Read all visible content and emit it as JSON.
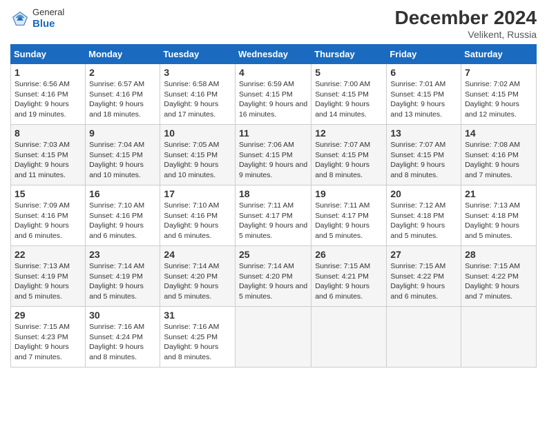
{
  "header": {
    "logo_general": "General",
    "logo_blue": "Blue",
    "month_year": "December 2024",
    "location": "Velikent, Russia"
  },
  "calendar": {
    "headers": [
      "Sunday",
      "Monday",
      "Tuesday",
      "Wednesday",
      "Thursday",
      "Friday",
      "Saturday"
    ],
    "weeks": [
      [
        null,
        {
          "day": "2",
          "sunrise": "6:57 AM",
          "sunset": "4:16 PM",
          "daylight": "9 hours and 18 minutes."
        },
        {
          "day": "3",
          "sunrise": "6:58 AM",
          "sunset": "4:16 PM",
          "daylight": "9 hours and 17 minutes."
        },
        {
          "day": "4",
          "sunrise": "6:59 AM",
          "sunset": "4:15 PM",
          "daylight": "9 hours and 16 minutes."
        },
        {
          "day": "5",
          "sunrise": "7:00 AM",
          "sunset": "4:15 PM",
          "daylight": "9 hours and 14 minutes."
        },
        {
          "day": "6",
          "sunrise": "7:01 AM",
          "sunset": "4:15 PM",
          "daylight": "9 hours and 13 minutes."
        },
        {
          "day": "7",
          "sunrise": "7:02 AM",
          "sunset": "4:15 PM",
          "daylight": "9 hours and 12 minutes."
        }
      ],
      [
        {
          "day": "1",
          "sunrise": "6:56 AM",
          "sunset": "4:16 PM",
          "daylight": "9 hours and 19 minutes."
        },
        {
          "day": "9",
          "sunrise": "7:04 AM",
          "sunset": "4:15 PM",
          "daylight": "9 hours and 10 minutes."
        },
        {
          "day": "10",
          "sunrise": "7:05 AM",
          "sunset": "4:15 PM",
          "daylight": "9 hours and 10 minutes."
        },
        {
          "day": "11",
          "sunrise": "7:06 AM",
          "sunset": "4:15 PM",
          "daylight": "9 hours and 9 minutes."
        },
        {
          "day": "12",
          "sunrise": "7:07 AM",
          "sunset": "4:15 PM",
          "daylight": "9 hours and 8 minutes."
        },
        {
          "day": "13",
          "sunrise": "7:07 AM",
          "sunset": "4:15 PM",
          "daylight": "9 hours and 8 minutes."
        },
        {
          "day": "14",
          "sunrise": "7:08 AM",
          "sunset": "4:16 PM",
          "daylight": "9 hours and 7 minutes."
        }
      ],
      [
        {
          "day": "8",
          "sunrise": "7:03 AM",
          "sunset": "4:15 PM",
          "daylight": "9 hours and 11 minutes."
        },
        {
          "day": "16",
          "sunrise": "7:10 AM",
          "sunset": "4:16 PM",
          "daylight": "9 hours and 6 minutes."
        },
        {
          "day": "17",
          "sunrise": "7:10 AM",
          "sunset": "4:16 PM",
          "daylight": "9 hours and 6 minutes."
        },
        {
          "day": "18",
          "sunrise": "7:11 AM",
          "sunset": "4:17 PM",
          "daylight": "9 hours and 5 minutes."
        },
        {
          "day": "19",
          "sunrise": "7:11 AM",
          "sunset": "4:17 PM",
          "daylight": "9 hours and 5 minutes."
        },
        {
          "day": "20",
          "sunrise": "7:12 AM",
          "sunset": "4:18 PM",
          "daylight": "9 hours and 5 minutes."
        },
        {
          "day": "21",
          "sunrise": "7:13 AM",
          "sunset": "4:18 PM",
          "daylight": "9 hours and 5 minutes."
        }
      ],
      [
        {
          "day": "15",
          "sunrise": "7:09 AM",
          "sunset": "4:16 PM",
          "daylight": "9 hours and 6 minutes."
        },
        {
          "day": "23",
          "sunrise": "7:14 AM",
          "sunset": "4:19 PM",
          "daylight": "9 hours and 5 minutes."
        },
        {
          "day": "24",
          "sunrise": "7:14 AM",
          "sunset": "4:20 PM",
          "daylight": "9 hours and 5 minutes."
        },
        {
          "day": "25",
          "sunrise": "7:14 AM",
          "sunset": "4:20 PM",
          "daylight": "9 hours and 5 minutes."
        },
        {
          "day": "26",
          "sunrise": "7:15 AM",
          "sunset": "4:21 PM",
          "daylight": "9 hours and 6 minutes."
        },
        {
          "day": "27",
          "sunrise": "7:15 AM",
          "sunset": "4:22 PM",
          "daylight": "9 hours and 6 minutes."
        },
        {
          "day": "28",
          "sunrise": "7:15 AM",
          "sunset": "4:22 PM",
          "daylight": "9 hours and 7 minutes."
        }
      ],
      [
        {
          "day": "22",
          "sunrise": "7:13 AM",
          "sunset": "4:19 PM",
          "daylight": "9 hours and 5 minutes."
        },
        {
          "day": "30",
          "sunrise": "7:16 AM",
          "sunset": "4:24 PM",
          "daylight": "9 hours and 8 minutes."
        },
        {
          "day": "31",
          "sunrise": "7:16 AM",
          "sunset": "4:25 PM",
          "daylight": "9 hours and 8 minutes."
        },
        null,
        null,
        null,
        null
      ],
      [
        {
          "day": "29",
          "sunrise": "7:15 AM",
          "sunset": "4:23 PM",
          "daylight": "9 hours and 7 minutes."
        },
        null,
        null,
        null,
        null,
        null,
        null
      ]
    ]
  }
}
